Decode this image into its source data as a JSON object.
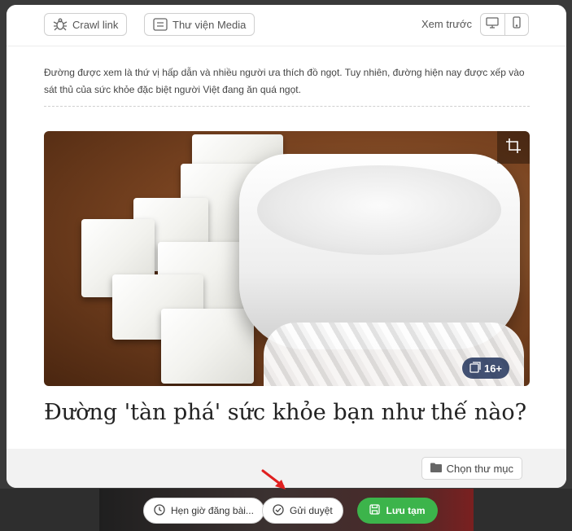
{
  "toolbar": {
    "crawl_label": "Crawl link",
    "media_label": "Thư viện Media",
    "preview_label": "Xem trước",
    "icons": {
      "crawl": "spider-icon",
      "media": "library-icon",
      "desktop": "desktop-icon",
      "mobile": "mobile-icon"
    }
  },
  "article": {
    "sapo": "Đường được xem là thứ vị hấp dẫn và nhiều người ưa thích đồ ngọt. Tuy nhiên, đường hiện nay được xếp vào sát thủ của sức khỏe đặc biệt người Việt đang ăn quá ngọt.",
    "image_count_badge": "16+",
    "title": "Đường 'tàn phá' sức khỏe bạn như thế nào?"
  },
  "footer": {
    "folder_label": "Chọn thư mục"
  },
  "actions": {
    "schedule_label": "Hẹn giờ đăng bài...",
    "submit_label": "Gửi duyệt",
    "save_label": "Lưu tạm"
  },
  "colors": {
    "accent_green": "#3cb44b",
    "annotation_arrow": "#e02020"
  }
}
